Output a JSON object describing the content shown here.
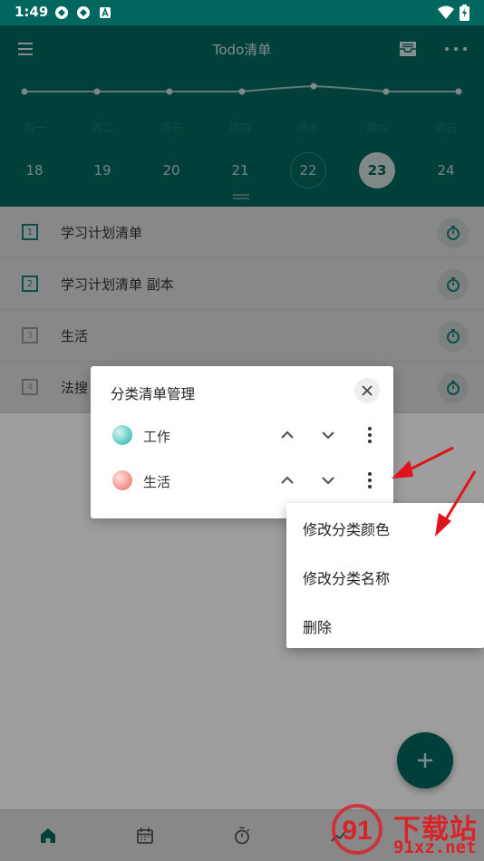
{
  "status_bar": {
    "time": "1:49",
    "icons": [
      "app-notification-icon",
      "app-notification-icon",
      "a-notification-icon",
      "wifi-icon",
      "battery-charging-icon"
    ]
  },
  "app_bar": {
    "title": "Todo清单",
    "icons": [
      "menu-icon",
      "archive-icon",
      "more-horizontal-icon"
    ]
  },
  "calendar": {
    "weekdays": [
      "周一",
      "周二",
      "周三",
      "周四",
      "周五",
      "周六",
      "周日"
    ],
    "dates": [
      "18",
      "19",
      "20",
      "21",
      "22",
      "23",
      "24"
    ],
    "today": "22",
    "selected": "23"
  },
  "task_lists": [
    {
      "index": "1",
      "label": "学习计划清单",
      "color": "#15807a"
    },
    {
      "index": "2",
      "label": "学习计划清单 副本",
      "color": "#15807a"
    },
    {
      "index": "3",
      "label": "生活",
      "color": "#9a9a9a"
    },
    {
      "index": "4",
      "label": "法搜",
      "color": "#9a9a9a"
    }
  ],
  "dialog": {
    "title": "分类清单管理",
    "categories": [
      {
        "label": "工作",
        "color": "#4fc7bf"
      },
      {
        "label": "生活",
        "color": "#f28b82"
      }
    ]
  },
  "popup_menu": {
    "items": [
      "修改分类颜色",
      "修改分类名称",
      "删除"
    ]
  },
  "fab": {
    "icon": "plus-icon"
  },
  "bottom_nav": {
    "items": [
      "home-icon",
      "calendar-icon",
      "stopwatch-icon",
      "chart-icon"
    ],
    "active": "home-icon"
  },
  "watermark": {
    "text_cn": "下载站",
    "text_en": "91xz.net",
    "logo_text": "91"
  },
  "colors": {
    "primary": "#00665e",
    "accent": "#15807a",
    "annotation_arrow": "#e0141e"
  }
}
